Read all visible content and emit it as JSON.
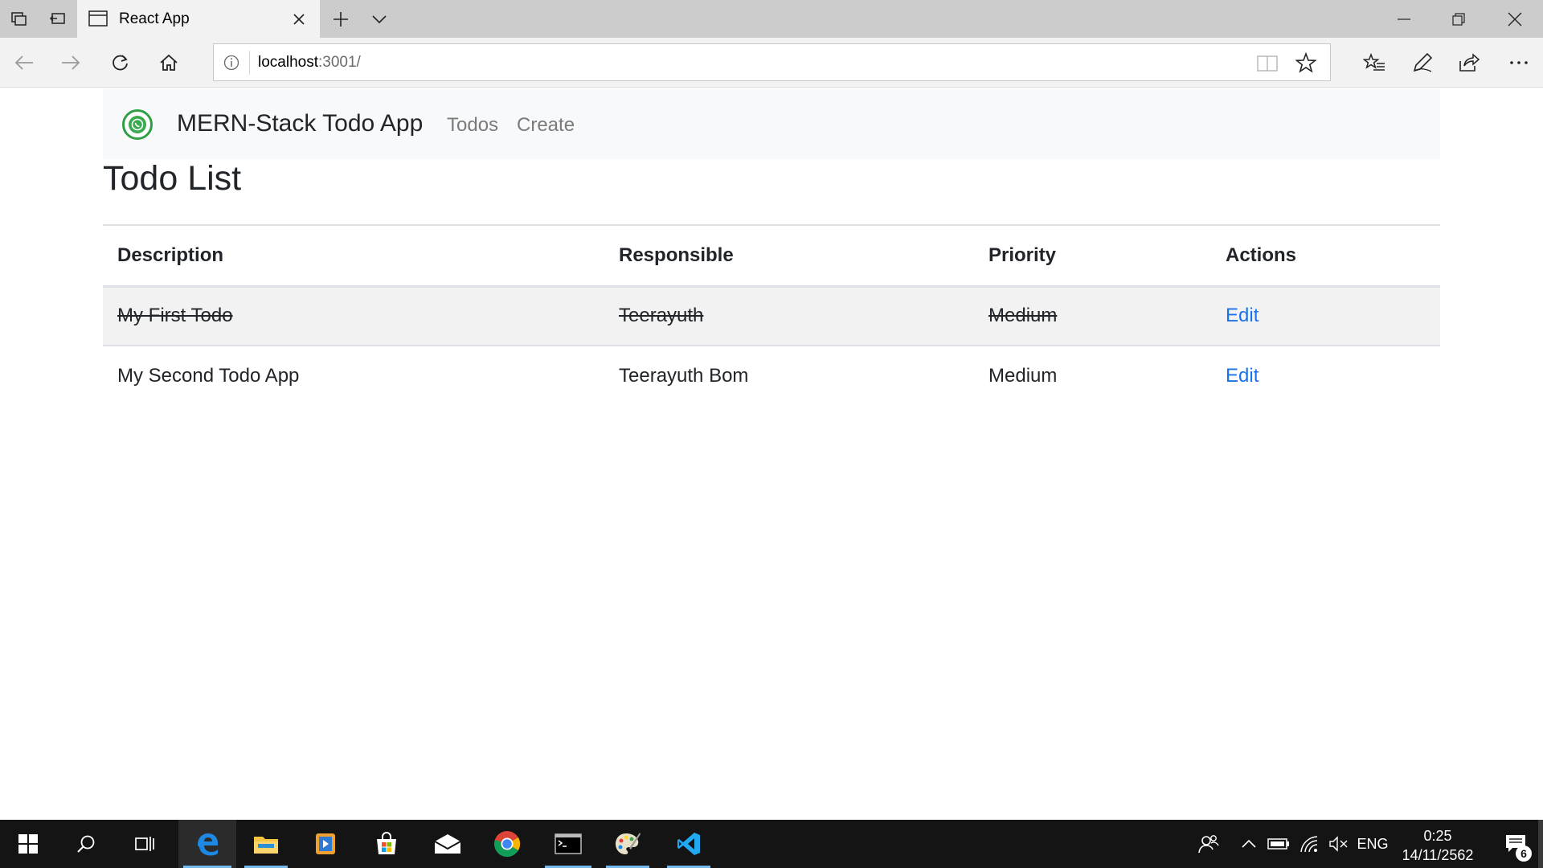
{
  "browser": {
    "tab_title": "React App",
    "url_host": "localhost",
    "url_rest": ":3001/"
  },
  "app": {
    "brand": "MERN-Stack Todo App",
    "nav": [
      {
        "label": "Todos"
      },
      {
        "label": "Create"
      }
    ],
    "page_title": "Todo List",
    "table": {
      "headers": [
        "Description",
        "Responsible",
        "Priority",
        "Actions"
      ],
      "rows": [
        {
          "description": "My First Todo",
          "responsible": "Teerayuth",
          "priority": "Medium",
          "action": "Edit",
          "completed": true
        },
        {
          "description": "My Second Todo App",
          "responsible": "Teerayuth Bom",
          "priority": "Medium",
          "action": "Edit",
          "completed": false
        }
      ]
    }
  },
  "taskbar": {
    "language": "ENG",
    "time": "0:25",
    "date": "14/11/2562",
    "notification_count": "6"
  },
  "colors": {
    "link": "#1a73e8",
    "navbar_bg": "#f8f9fa",
    "taskbar_bg": "#141414"
  }
}
